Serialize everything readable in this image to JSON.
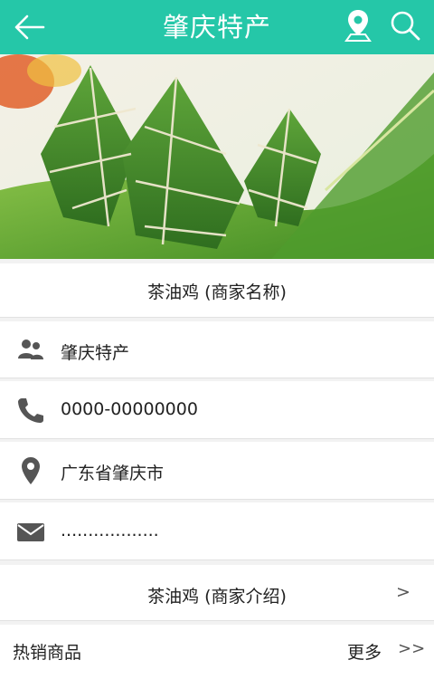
{
  "header": {
    "title": "肇庆特产",
    "back_icon": "arrow-left-icon",
    "location_icon": "map-pin-icon",
    "search_icon": "search-icon",
    "color": "#25c7a8"
  },
  "merchant": {
    "name": "茶油鸡 (商家名称)",
    "category": "肇庆特产",
    "phone": "0000-00000000",
    "address": "广东省肇庆市",
    "email": "..................",
    "intro": "茶油鸡 (商家介绍)",
    "intro_arrow": ">"
  },
  "hot": {
    "label": "热销商品",
    "more": "更多",
    "more_arrow": ">>"
  }
}
